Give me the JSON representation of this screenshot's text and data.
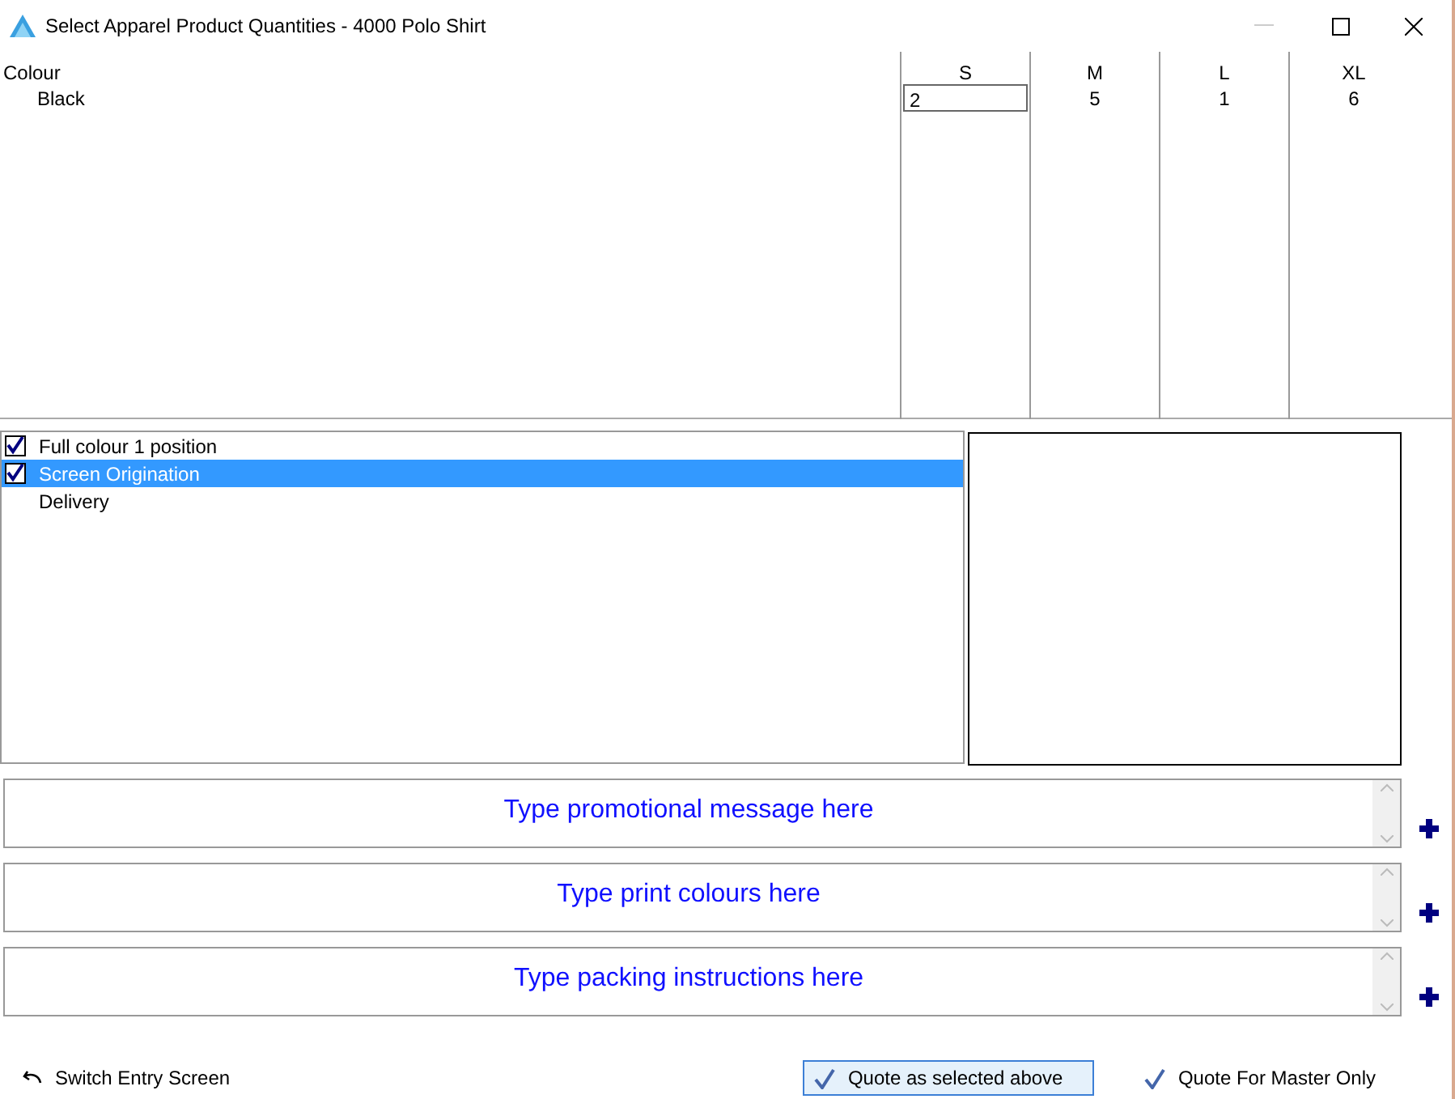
{
  "window": {
    "title": "Select Apparel Product Quantities - 4000 Polo Shirt"
  },
  "grid": {
    "row_header": "Colour",
    "columns": [
      "S",
      "M",
      "L",
      "XL"
    ],
    "rows": [
      {
        "label": "Black",
        "cells": [
          {
            "value": "2",
            "editing": true
          },
          {
            "value": "5",
            "editing": false
          },
          {
            "value": "1",
            "editing": false
          },
          {
            "value": "6",
            "editing": false
          }
        ]
      }
    ]
  },
  "options": [
    {
      "label": "Full colour 1 position",
      "checked": true,
      "selected": false
    },
    {
      "label": "Screen Origination",
      "checked": true,
      "selected": true
    },
    {
      "label": "Delivery",
      "checked": false,
      "selected": false
    }
  ],
  "text_boxes": [
    {
      "placeholder": "Type promotional message here"
    },
    {
      "placeholder": "Type print colours here"
    },
    {
      "placeholder": "Type packing instructions here"
    }
  ],
  "footer": {
    "switch": "Switch Entry Screen",
    "options": [
      {
        "label": "Quote as selected above",
        "selected": true
      },
      {
        "label": "Quote For Master Only",
        "selected": false
      }
    ]
  }
}
